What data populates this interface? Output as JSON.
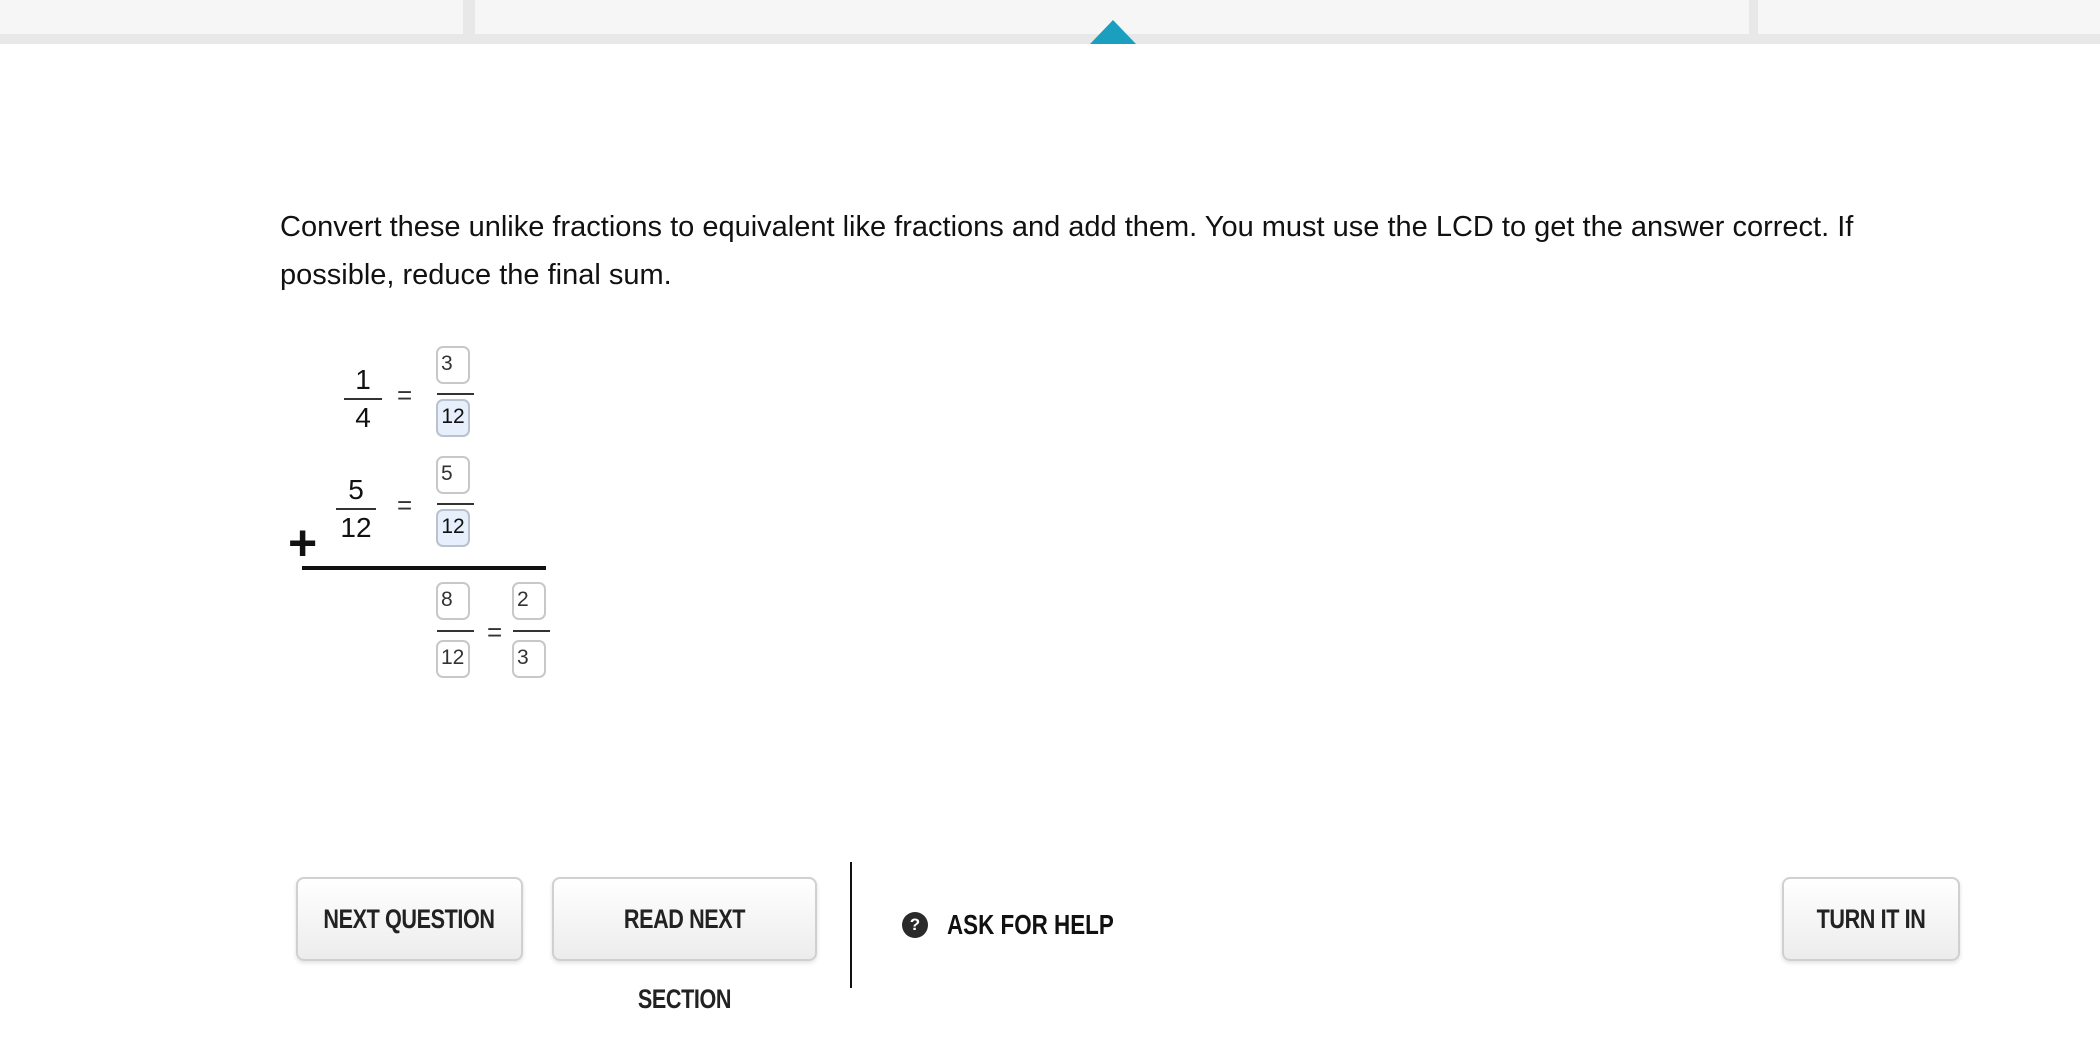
{
  "nav": {
    "active_indicator_color": "#1b9fbe"
  },
  "question": {
    "instructions": "Convert these unlike fractions to equivalent like fractions and add them. You must use the LCD to get the answer correct. If possible, reduce the final sum."
  },
  "problem": {
    "fraction1": {
      "numerator": "1",
      "denominator": "4"
    },
    "fraction1_equiv": {
      "numerator": "3",
      "denominator": "12"
    },
    "fraction2": {
      "numerator": "5",
      "denominator": "12"
    },
    "fraction2_equiv": {
      "numerator": "5",
      "denominator": "12"
    },
    "sum": {
      "numerator": "8",
      "denominator": "12"
    },
    "reduced_sum": {
      "numerator": "2",
      "denominator": "3"
    },
    "operator": "+",
    "equals": "="
  },
  "actions": {
    "next_question": "NEXT QUESTION",
    "read_next_section": "READ NEXT SECTION",
    "ask_for_help": "ASK FOR HELP",
    "help_icon": "question-circle-icon",
    "turn_it_in": "TURN IT IN"
  }
}
